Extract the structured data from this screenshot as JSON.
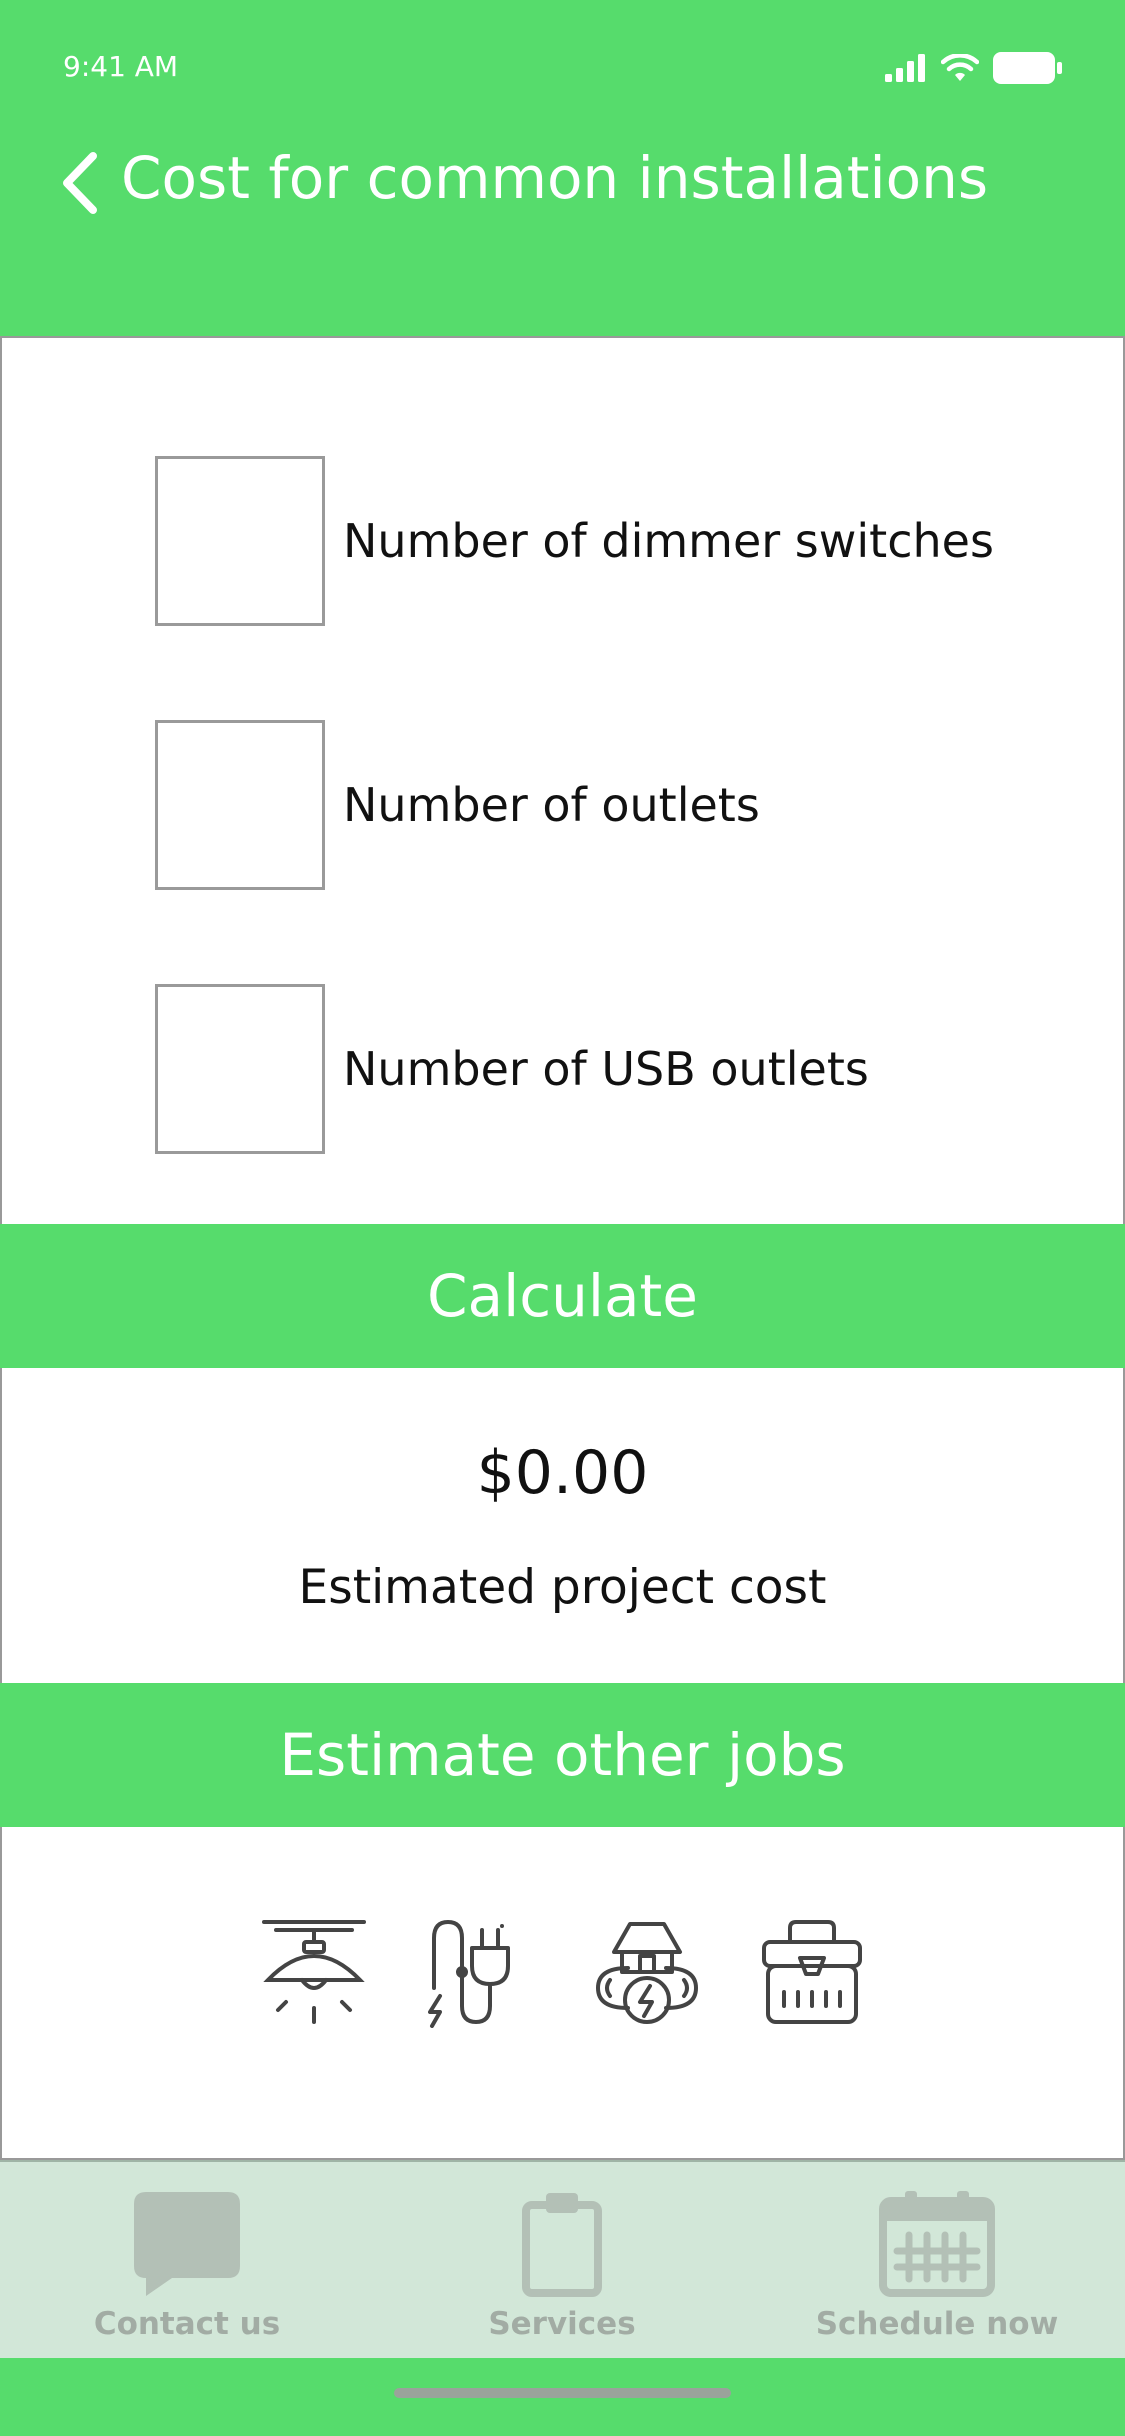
{
  "status": {
    "time": "9:41 AM"
  },
  "header": {
    "title": "Cost for common installations",
    "back_icon": "chevron-left-icon"
  },
  "inputs": [
    {
      "label": "Number of dimmer switches",
      "value": ""
    },
    {
      "label": "Number of outlets",
      "value": ""
    },
    {
      "label": "Number of USB outlets",
      "value": ""
    }
  ],
  "calculate_label": "Calculate",
  "result": {
    "value": "$0.00",
    "label": "Estimated project cost"
  },
  "other_jobs": {
    "title": "Estimate other jobs",
    "icons": [
      "ceiling-lamp-icon",
      "electric-plug-icon",
      "home-energy-icon",
      "toolbox-icon"
    ]
  },
  "tabs": [
    {
      "label": "Contact us",
      "icon": "chat-bubble-icon"
    },
    {
      "label": "Services",
      "icon": "clipboard-icon"
    },
    {
      "label": "Schedule now",
      "icon": "calendar-icon"
    }
  ],
  "colors": {
    "accent": "#56dc6c",
    "tab_bar": "#d2e7d8",
    "tab_inactive": "#a2aca4"
  }
}
